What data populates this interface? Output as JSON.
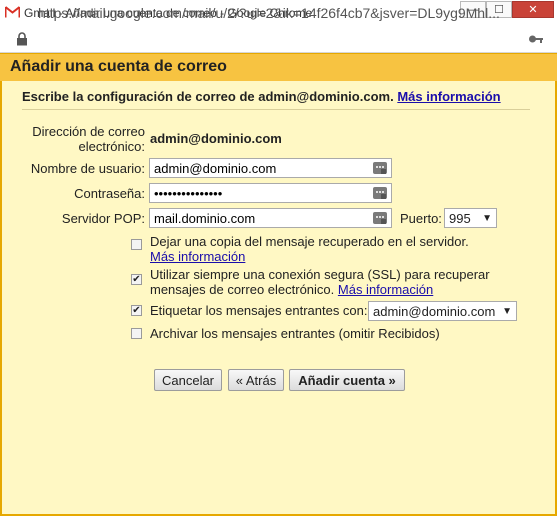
{
  "window": {
    "title": "Gmail - Añadir una cuenta de correo - Google Chrome",
    "url": "https://mail.google.com/mail/u/2/?ui=2&ik=14f26f4cb7&jsver=DL9yg9Mhl...",
    "controls": {
      "minimize": "—",
      "maximize": "☐",
      "close": "✕"
    }
  },
  "dialog": {
    "title": "Añadir una cuenta de correo",
    "intro_text": "Escribe la configuración de correo de admin@dominio.com.",
    "intro_link": "Más información",
    "email_label_line1": "Dirección de correo",
    "email_label_line2": "electrónico:",
    "email_value": "admin@dominio.com",
    "username_label": "Nombre de usuario:",
    "username_value": "admin@dominio.com",
    "password_label": "Contraseña:",
    "password_value": "•••••••••••••••",
    "server_label": "Servidor POP:",
    "server_value": "mail.dominio.com",
    "port_label": "Puerto:",
    "port_value": "995",
    "options": [
      {
        "text": "Dejar una copia del mensaje recuperado en el servidor.",
        "link": "Más información",
        "checked": false
      },
      {
        "text_line1": "Utilizar siempre una conexión segura (SSL) para recuperar",
        "text_line2": "mensajes de correo electrónico.",
        "link": "Más información",
        "checked": true
      },
      {
        "text": "Etiquetar los mensajes entrantes con:",
        "select_value": "admin@dominio.com",
        "checked": true
      },
      {
        "text": "Archivar los mensajes entrantes (omitir Recibidos)",
        "checked": false
      }
    ],
    "buttons": {
      "cancel": "Cancelar",
      "back": "« Atrás",
      "add": "Añadir cuenta »"
    }
  },
  "colors": {
    "header": "#f7c341",
    "dialog_bg": "#fff8c4",
    "border": "#e6a800",
    "link": "#1a0dab"
  }
}
